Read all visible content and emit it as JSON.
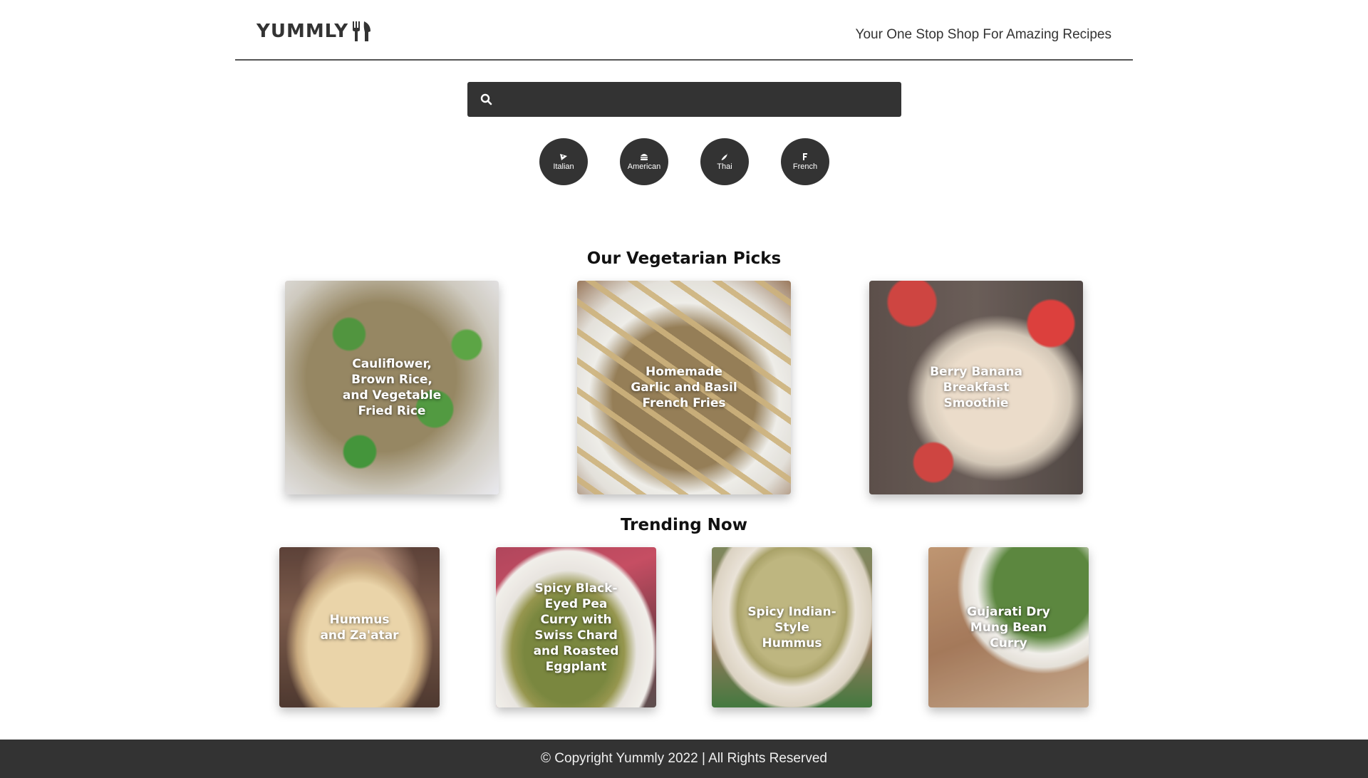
{
  "header": {
    "logo_text": "YUMMLY",
    "tagline": "Your One Stop Shop For Amazing Recipes"
  },
  "search": {
    "placeholder": "",
    "value": ""
  },
  "cuisines": [
    {
      "label": "Italian",
      "icon": "pizza-icon"
    },
    {
      "label": "American",
      "icon": "burger-icon"
    },
    {
      "label": "Thai",
      "icon": "chili-icon"
    },
    {
      "label": "French",
      "icon": "french-icon"
    }
  ],
  "vegetarian": {
    "title": "Our Vegetarian Picks",
    "recipes": [
      {
        "title": "Cauliflower, Brown Rice, and Vegetable Fried Rice"
      },
      {
        "title": "Homemade Garlic and Basil French Fries"
      },
      {
        "title": "Berry Banana Breakfast Smoothie"
      }
    ]
  },
  "trending": {
    "title": "Trending Now",
    "recipes": [
      {
        "title": "Hummus and Za'atar"
      },
      {
        "title": "Spicy Black-Eyed Pea Curry with Swiss Chard and Roasted Eggplant"
      },
      {
        "title": "Spicy Indian-Style Hummus"
      },
      {
        "title": "Gujarati Dry Mung Bean Curry"
      }
    ]
  },
  "footer": {
    "text": "© Copyright Yummly 2022 | All Rights Reserved"
  },
  "colors": {
    "dark": "#333333",
    "background": "#ffffff",
    "footer_text": "#f0f0f0"
  }
}
